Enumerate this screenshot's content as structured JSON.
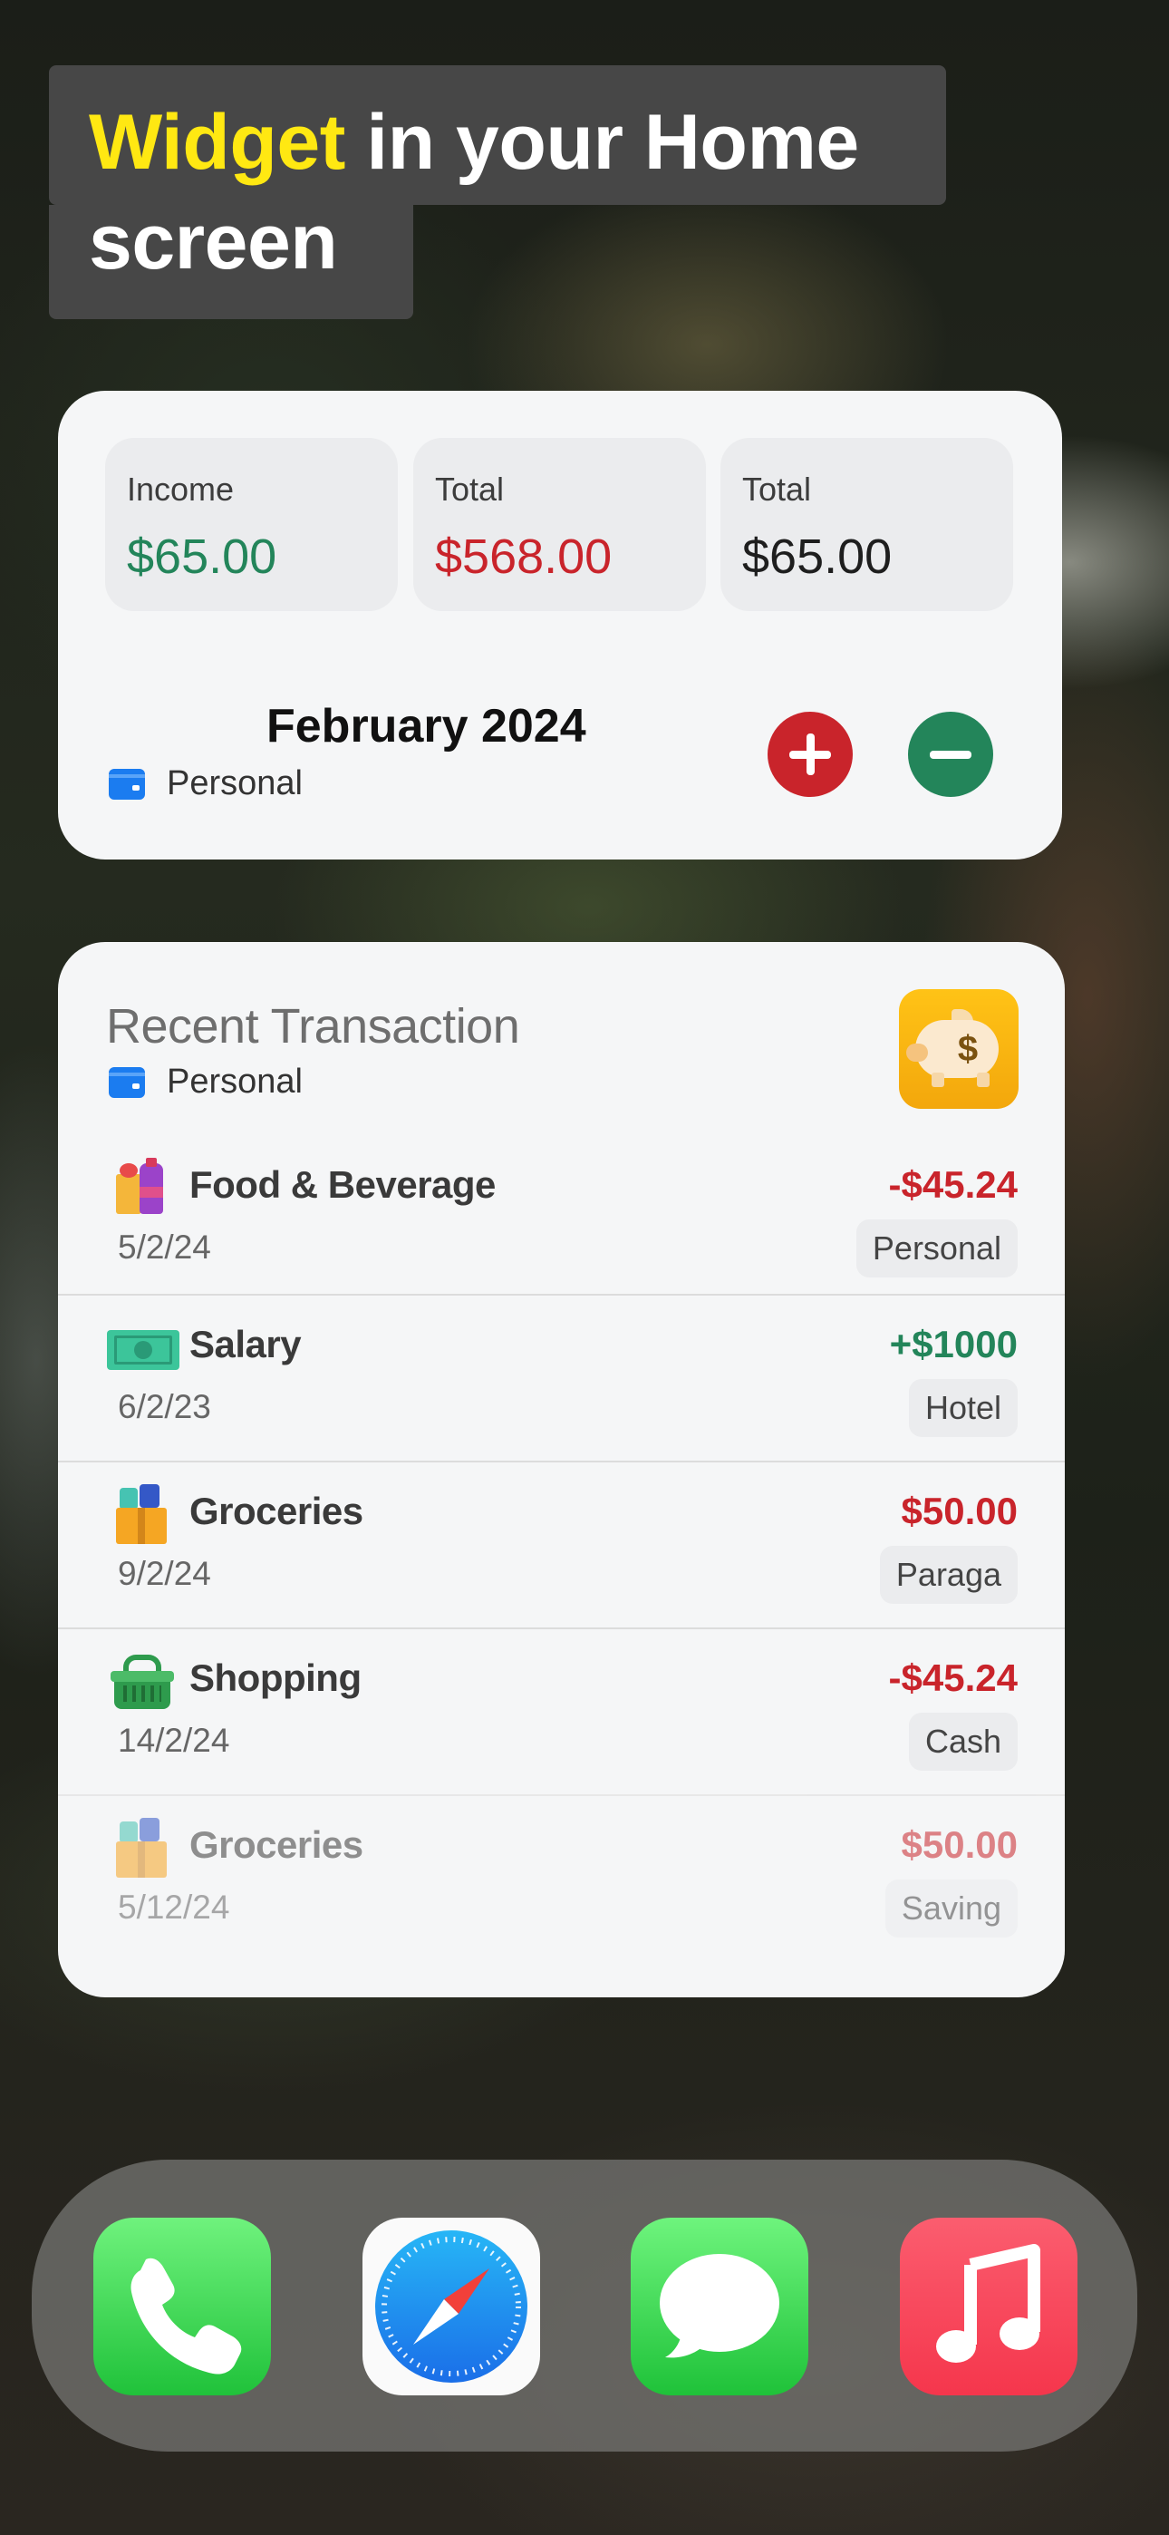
{
  "headline": {
    "highlight": "Widget",
    "rest_line1": " in your Home",
    "line2": "screen"
  },
  "summary_widget": {
    "tiles": [
      {
        "label": "Income",
        "value": "$65.00",
        "color": "#23855a"
      },
      {
        "label": "Total",
        "value": "$568.00",
        "color": "#c9242b"
      },
      {
        "label": "Total",
        "value": "$65.00",
        "color": "#1e1e1e"
      }
    ],
    "month": "February 2024",
    "wallet": "Personal",
    "add_icon": "plus-circle-icon",
    "subtract_icon": "minus-circle-icon"
  },
  "recent_widget": {
    "title": "Recent Transaction",
    "wallet": "Personal",
    "app_icon": "piggy-bank-icon",
    "transactions": [
      {
        "name": "Food & Beverage",
        "date": "5/2/24",
        "amount": "-$45.24",
        "tag": "Personal",
        "amount_color": "#c9242b",
        "icon": "food-beverage-icon"
      },
      {
        "name": "Salary",
        "date": "6/2/23",
        "amount": "+$1000",
        "tag": "Hotel",
        "amount_color": "#23855a",
        "icon": "cash-icon"
      },
      {
        "name": "Groceries",
        "date": "9/2/24",
        "amount": "$50.00",
        "tag": "Paraga",
        "amount_color": "#c9242b",
        "icon": "groceries-icon"
      },
      {
        "name": "Shopping",
        "date": "14/2/24",
        "amount": "-$45.24",
        "tag": "Cash",
        "amount_color": "#c9242b",
        "icon": "shopping-basket-icon"
      },
      {
        "name": "Groceries",
        "date": "5/12/24",
        "amount": "$50.00",
        "tag": "Saving",
        "amount_color": "#c9242b",
        "icon": "groceries-icon"
      }
    ]
  },
  "dock": {
    "apps": [
      {
        "name": "Phone",
        "icon": "phone-icon"
      },
      {
        "name": "Safari",
        "icon": "compass-icon"
      },
      {
        "name": "Messages",
        "icon": "speech-bubble-icon"
      },
      {
        "name": "Music",
        "icon": "music-note-icon"
      }
    ]
  }
}
